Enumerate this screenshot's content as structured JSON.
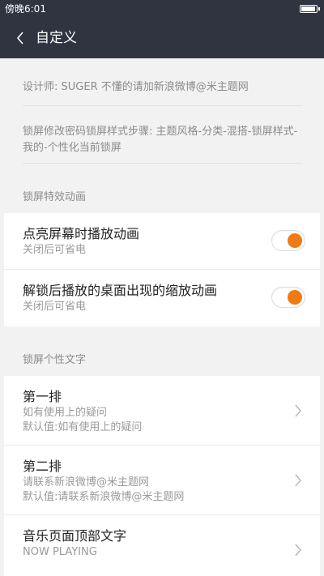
{
  "status_bar": {
    "time": "傍晚6:01"
  },
  "header": {
    "title": "自定义"
  },
  "info": [
    "设计师: SUGER  不懂的请加新浪微博@米主题网",
    "锁屏修改密码锁屏样式步骤: 主题风格-分类-混搭-锁屏样式-我的-个性化当前锁屏"
  ],
  "section1": {
    "title": "锁屏特效动画",
    "items": [
      {
        "title": "点亮屏幕时播放动画",
        "subtitle": "关闭后可省电",
        "enabled": true
      },
      {
        "title": "解锁后播放的桌面出现的缩放动画",
        "subtitle": "关闭后可省电",
        "enabled": true
      }
    ]
  },
  "section2": {
    "title": "锁屏个性文字",
    "items": [
      {
        "title": "第一排",
        "value": "如有使用上的疑问",
        "default": "默认值:如有使用上的疑问"
      },
      {
        "title": "第二排",
        "value": "请联系新浪微博@米主题网",
        "default": "默认值:请联系新浪微博@米主题网"
      },
      {
        "title": "音乐页面顶部文字",
        "value": "NOW PLAYING",
        "default": ""
      }
    ]
  },
  "colors": {
    "header_bg": "#2f3440",
    "accent": "#f07a13",
    "background": "#f2f2f2"
  },
  "icons": {
    "back": "chevron-left-icon",
    "nav": "chevron-right-icon",
    "battery": "battery-icon"
  }
}
